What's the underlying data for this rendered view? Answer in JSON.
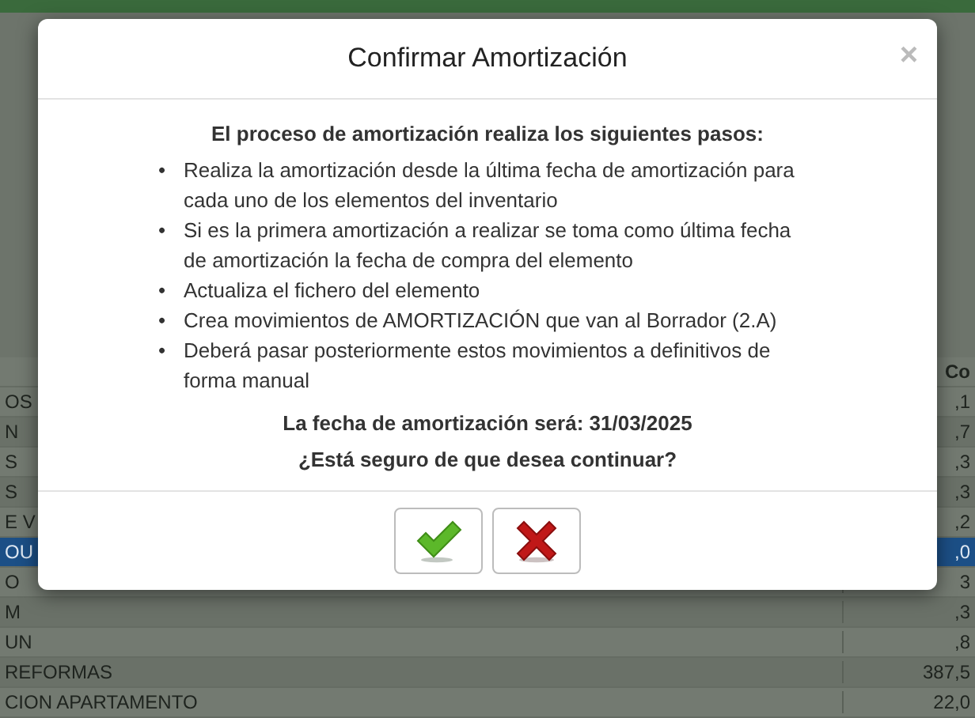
{
  "background_table": {
    "header_column_2": "Co",
    "rows": [
      {
        "column_1": "OS",
        "column_2": ",1",
        "selected": false
      },
      {
        "column_1": "N",
        "column_2": ",7",
        "selected": false
      },
      {
        "column_1": "S",
        "column_2": ",3",
        "selected": false
      },
      {
        "column_1": "S",
        "column_2": ",3",
        "selected": false
      },
      {
        "column_1": "E V",
        "column_2": ",2",
        "selected": false
      },
      {
        "column_1": "OU",
        "column_2": ",0",
        "selected": true
      },
      {
        "column_1": "O",
        "column_2": "3",
        "selected": false
      },
      {
        "column_1": "M",
        "column_2": ",3",
        "selected": false
      },
      {
        "column_1": "UN",
        "column_2": ",8",
        "selected": false
      },
      {
        "column_1": "REFORMAS",
        "column_2": "387,5",
        "selected": false
      },
      {
        "column_1": "CION APARTAMENTO",
        "column_2": "22,0",
        "selected": false
      }
    ]
  },
  "dialog": {
    "title": "Confirmar Amortización",
    "close": "×",
    "intro": "El proceso de amortización realiza los siguientes pasos:",
    "steps": [
      {
        "marker": "•",
        "text": "Realiza la amortización desde la última fecha de amortización para cada uno de los elementos del inventario"
      },
      {
        "marker": "•",
        "text": "Si es la primera amortización a realizar se toma como última fecha de amortización la fecha de compra del elemento"
      },
      {
        "marker": "•",
        "text": "Actualiza el fichero del elemento"
      },
      {
        "marker": "•",
        "text": "Crea movimientos de AMORTIZACIÓN que van al Borrador (2.A)"
      },
      {
        "marker": "•",
        "text": "Deberá pasar posteriormente estos movimientos a definitivos de forma manual"
      }
    ],
    "date_line": "La fecha de amortización será: **31/03/2025**",
    "question": "¿Está seguro de que desea continuar?",
    "buttons": [
      {
        "kind": "confirm"
      },
      {
        "kind": "cancel"
      }
    ]
  }
}
